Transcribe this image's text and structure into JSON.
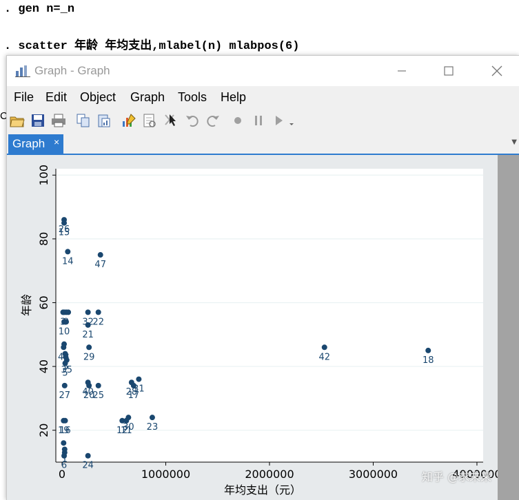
{
  "console": {
    "line1": ". gen n=_n",
    "line2": ". scatter 年龄 年均支出,mlabel(n) mlabpos(6)"
  },
  "window": {
    "title": "Graph - Graph",
    "icon": "bar-chart-icon",
    "controls": [
      "minimize-icon",
      "maximize-icon",
      "close-icon"
    ]
  },
  "menu": [
    "File",
    "Edit",
    "Object",
    "Graph",
    "Tools",
    "Help"
  ],
  "toolbar": [
    "open-icon",
    "save-icon",
    "print-icon",
    "copy-icon",
    "paste-graph-icon",
    "graph-editor-icon",
    "rename-icon",
    "pointer-icon",
    "undo-icon",
    "redo-icon",
    "record-icon",
    "pause-icon",
    "play-icon"
  ],
  "tab": {
    "label": "Graph",
    "close": "×"
  },
  "watermark": "知乎 @求未来",
  "colors": {
    "marker": "#1a476f",
    "tab": "#2e7bcf",
    "plot_bg": "#ffffff",
    "outer_bg": "#e7eaec",
    "grid": "#eaf2f3"
  },
  "chart_data": {
    "type": "scatter",
    "title": "",
    "xlabel": "年均支出（元）",
    "ylabel": "年龄",
    "xlim": [
      -60000,
      4060000
    ],
    "ylim": [
      10,
      102
    ],
    "xticks": [
      0,
      1000000,
      2000000,
      3000000,
      4000000
    ],
    "xtick_labels": [
      "0",
      "1000000",
      "2000000",
      "3000000",
      "4000000"
    ],
    "yticks": [
      20,
      40,
      60,
      80,
      100
    ],
    "ytick_labels": [
      "20",
      "40",
      "60",
      "80",
      "100"
    ],
    "grid": true,
    "points": [
      {
        "x": 20000,
        "y": 86,
        "label": "26"
      },
      {
        "x": 20000,
        "y": 85,
        "label": "15"
      },
      {
        "x": 55000,
        "y": 76,
        "label": "14"
      },
      {
        "x": 370000,
        "y": 75,
        "label": "47"
      },
      {
        "x": 10000,
        "y": 57,
        "label": "3"
      },
      {
        "x": 40000,
        "y": 57,
        "label": "9"
      },
      {
        "x": 20000,
        "y": 57,
        "label": ""
      },
      {
        "x": 60000,
        "y": 57,
        "label": ""
      },
      {
        "x": 250000,
        "y": 57,
        "label": "32"
      },
      {
        "x": 350000,
        "y": 57,
        "label": "22"
      },
      {
        "x": 20000,
        "y": 54,
        "label": "10"
      },
      {
        "x": 40000,
        "y": 54,
        "label": ""
      },
      {
        "x": 250000,
        "y": 53,
        "label": "21"
      },
      {
        "x": 20000,
        "y": 47,
        "label": ""
      },
      {
        "x": 15000,
        "y": 46,
        "label": "48"
      },
      {
        "x": 260000,
        "y": 46,
        "label": "29"
      },
      {
        "x": 2530000,
        "y": 46,
        "label": "42"
      },
      {
        "x": 3530000,
        "y": 45,
        "label": "18"
      },
      {
        "x": 30000,
        "y": 44,
        "label": "4"
      },
      {
        "x": 35000,
        "y": 43,
        "label": "3"
      },
      {
        "x": 45000,
        "y": 42,
        "label": "35"
      },
      {
        "x": 30000,
        "y": 41,
        "label": "5"
      },
      {
        "x": 25000,
        "y": 34,
        "label": "27"
      },
      {
        "x": 250000,
        "y": 35,
        "label": "40"
      },
      {
        "x": 260000,
        "y": 34,
        "label": "20"
      },
      {
        "x": 350000,
        "y": 34,
        "label": "25"
      },
      {
        "x": 740000,
        "y": 36,
        "label": "31"
      },
      {
        "x": 670000,
        "y": 35,
        "label": "28"
      },
      {
        "x": 690000,
        "y": 34,
        "label": "17"
      },
      {
        "x": 15000,
        "y": 23,
        "label": "19"
      },
      {
        "x": 30000,
        "y": 23,
        "label": "16"
      },
      {
        "x": 580000,
        "y": 23,
        "label": "12"
      },
      {
        "x": 640000,
        "y": 24,
        "label": "30"
      },
      {
        "x": 620000,
        "y": 23,
        "label": "11"
      },
      {
        "x": 870000,
        "y": 24,
        "label": "23"
      },
      {
        "x": 15000,
        "y": 16,
        "label": ""
      },
      {
        "x": 25000,
        "y": 14,
        "label": "1"
      },
      {
        "x": 25000,
        "y": 13,
        "label": ""
      },
      {
        "x": 20000,
        "y": 12,
        "label": "6"
      },
      {
        "x": 250000,
        "y": 12,
        "label": "24"
      }
    ]
  }
}
